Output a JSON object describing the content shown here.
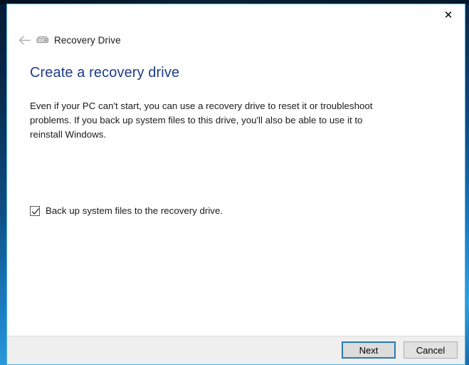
{
  "window": {
    "nav_title": "Recovery Drive",
    "close_label": "✕",
    "back_icon": "back-arrow-icon",
    "drive_icon": "hard-drive-icon"
  },
  "content": {
    "page_title": "Create a recovery drive",
    "description": "Even if your PC can't start, you can use a recovery drive to reset it or troubleshoot problems. If you back up system files to this drive, you'll also be able to use it to reinstall Windows.",
    "checkbox": {
      "label": "Back up system files to the recovery drive.",
      "checked": "true"
    }
  },
  "footer": {
    "next_label": "Next",
    "cancel_label": "Cancel"
  },
  "colors": {
    "accent_heading": "#1f3c87",
    "focus_border": "#2a7ab0",
    "window_border": "#4ab0e8",
    "footer_background": "#efefef",
    "desktop": "#0f4f86"
  }
}
